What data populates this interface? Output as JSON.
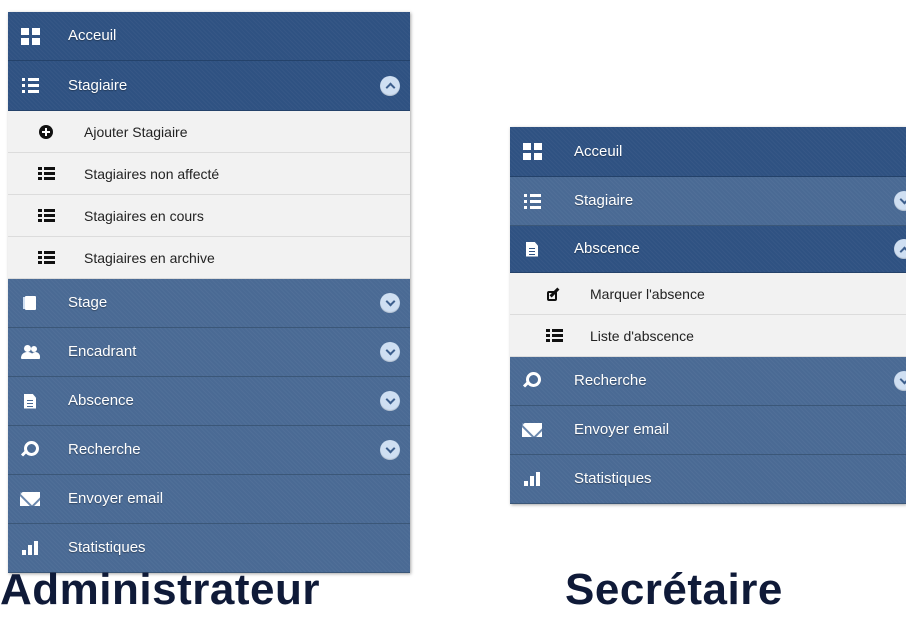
{
  "admin": {
    "caption": "Administrateur",
    "items": [
      {
        "label": "Acceuil",
        "icon": "dashboard-icon"
      },
      {
        "label": "Stagiaire",
        "icon": "list-icon",
        "expanded": true,
        "submenu": [
          {
            "label": "Ajouter Stagiaire",
            "icon": "plus-circle-icon"
          },
          {
            "label": "Stagiaires non affecté",
            "icon": "table-list-icon"
          },
          {
            "label": "Stagiaires en cours",
            "icon": "table-list-icon"
          },
          {
            "label": "Stagiaires en archive",
            "icon": "table-list-icon"
          }
        ]
      },
      {
        "label": "Stage",
        "icon": "book-icon",
        "expanded": false
      },
      {
        "label": "Encadrant",
        "icon": "users-icon",
        "expanded": false
      },
      {
        "label": "Abscence",
        "icon": "document-icon",
        "expanded": false
      },
      {
        "label": "Recherche",
        "icon": "search-icon",
        "expanded": false
      },
      {
        "label": "Envoyer email",
        "icon": "envelope-icon"
      },
      {
        "label": "Statistiques",
        "icon": "bar-chart-icon"
      }
    ]
  },
  "secretaire": {
    "caption": "Secrétaire",
    "items": [
      {
        "label": "Acceuil",
        "icon": "dashboard-icon"
      },
      {
        "label": "Stagiaire",
        "icon": "list-icon",
        "expanded": false
      },
      {
        "label": "Abscence",
        "icon": "document-icon",
        "expanded": true,
        "submenu": [
          {
            "label": "Marquer l'absence",
            "icon": "edit-icon"
          },
          {
            "label": "Liste d'abscence",
            "icon": "table-list-icon"
          }
        ]
      },
      {
        "label": "Recherche",
        "icon": "search-icon",
        "expanded": false
      },
      {
        "label": "Envoyer email",
        "icon": "envelope-icon"
      },
      {
        "label": "Statistiques",
        "icon": "bar-chart-icon"
      }
    ]
  },
  "colors": {
    "menu_bg": "#4a6a94",
    "menu_bg_active": "#2f5282",
    "submenu_bg": "#f2f2f2",
    "chevron_bg": "#cfdff2",
    "caption_text": "#0f1a38"
  }
}
